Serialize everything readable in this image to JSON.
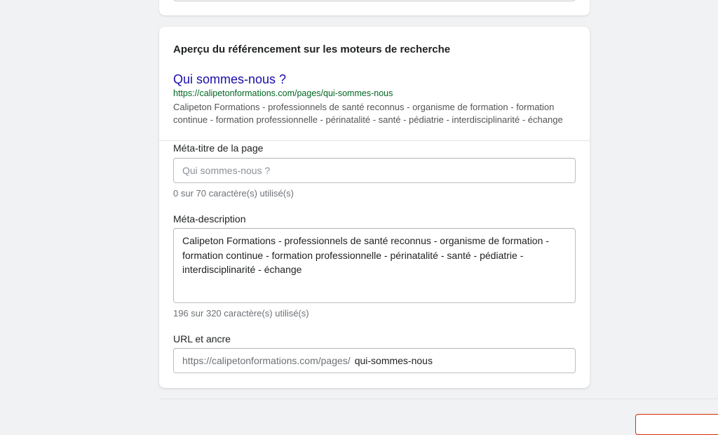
{
  "seo": {
    "card_title": "Aperçu du référencement sur les moteurs de recherche",
    "preview": {
      "title": "Qui sommes-nous ?",
      "url": "https://calipetonformations.com/pages/qui-sommes-nous",
      "description": "Calipeton Formations - professionnels de santé reconnus - organisme de formation - formation continue - formation professionnelle - périnatalité - santé - pédiatrie - interdisciplinarité - échange"
    },
    "meta_title": {
      "label": "Méta-titre de la page",
      "placeholder": "Qui sommes-nous ?",
      "help": "0 sur 70 caractère(s) utilisé(s)"
    },
    "meta_description": {
      "label": "Méta-description",
      "value": "Calipeton Formations - professionnels de santé reconnus - organisme de formation - formation continue - formation professionnelle - périnatalité - santé - pédiatrie - interdisciplinarité - échange",
      "help": "196 sur 320 caractère(s) utilisé(s)"
    },
    "url_handle": {
      "label": "URL et ancre",
      "prefix": "https://calipetonformations.com/pages/",
      "value": "qui-sommes-nous"
    }
  },
  "colors": {
    "preview_title": "#1a0dab",
    "preview_url": "#006621",
    "danger_outline": "#d82c0d"
  }
}
